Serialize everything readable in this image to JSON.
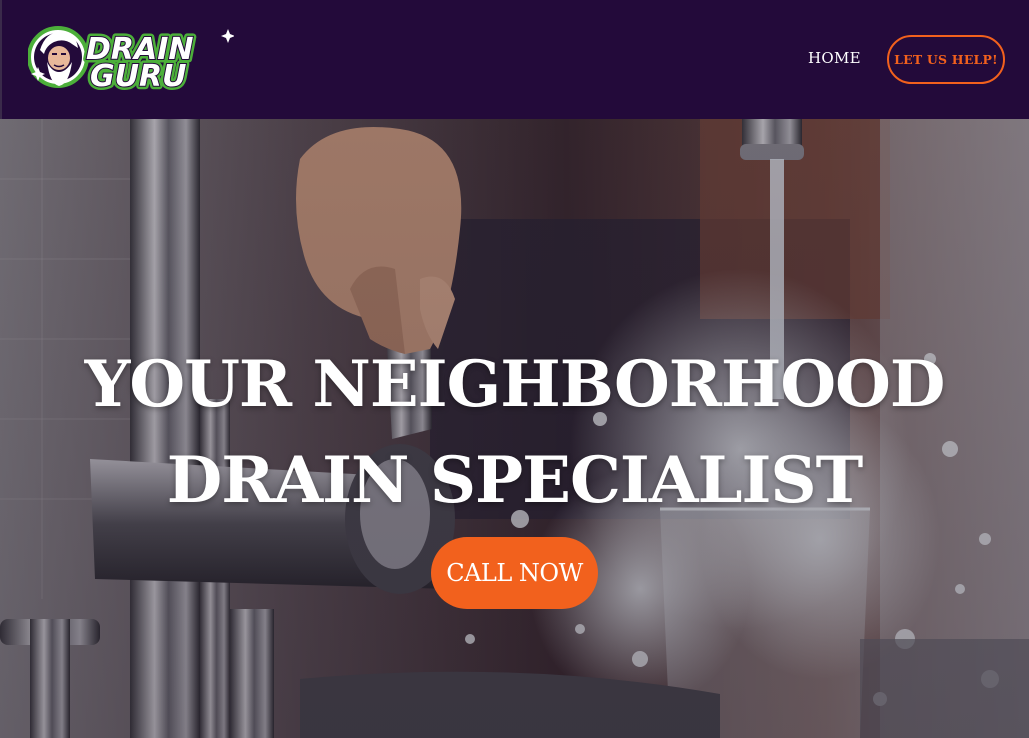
{
  "brand": {
    "logo_line1": "DRAIN",
    "logo_line2": "GURU"
  },
  "nav": {
    "home_label": "HOME",
    "cta_label": "LET US HELP!"
  },
  "hero": {
    "title_line1": "YOUR NEIGHBORHOOD",
    "title_line2": "DRAIN SPECIALIST",
    "button_label": "CALL NOW",
    "image_description": "kitchen-faucet-water-splash"
  },
  "colors": {
    "header_bg": "#230a3a",
    "accent_orange": "#f2611d",
    "logo_green": "#4caf3a",
    "text_white": "#ffffff"
  }
}
